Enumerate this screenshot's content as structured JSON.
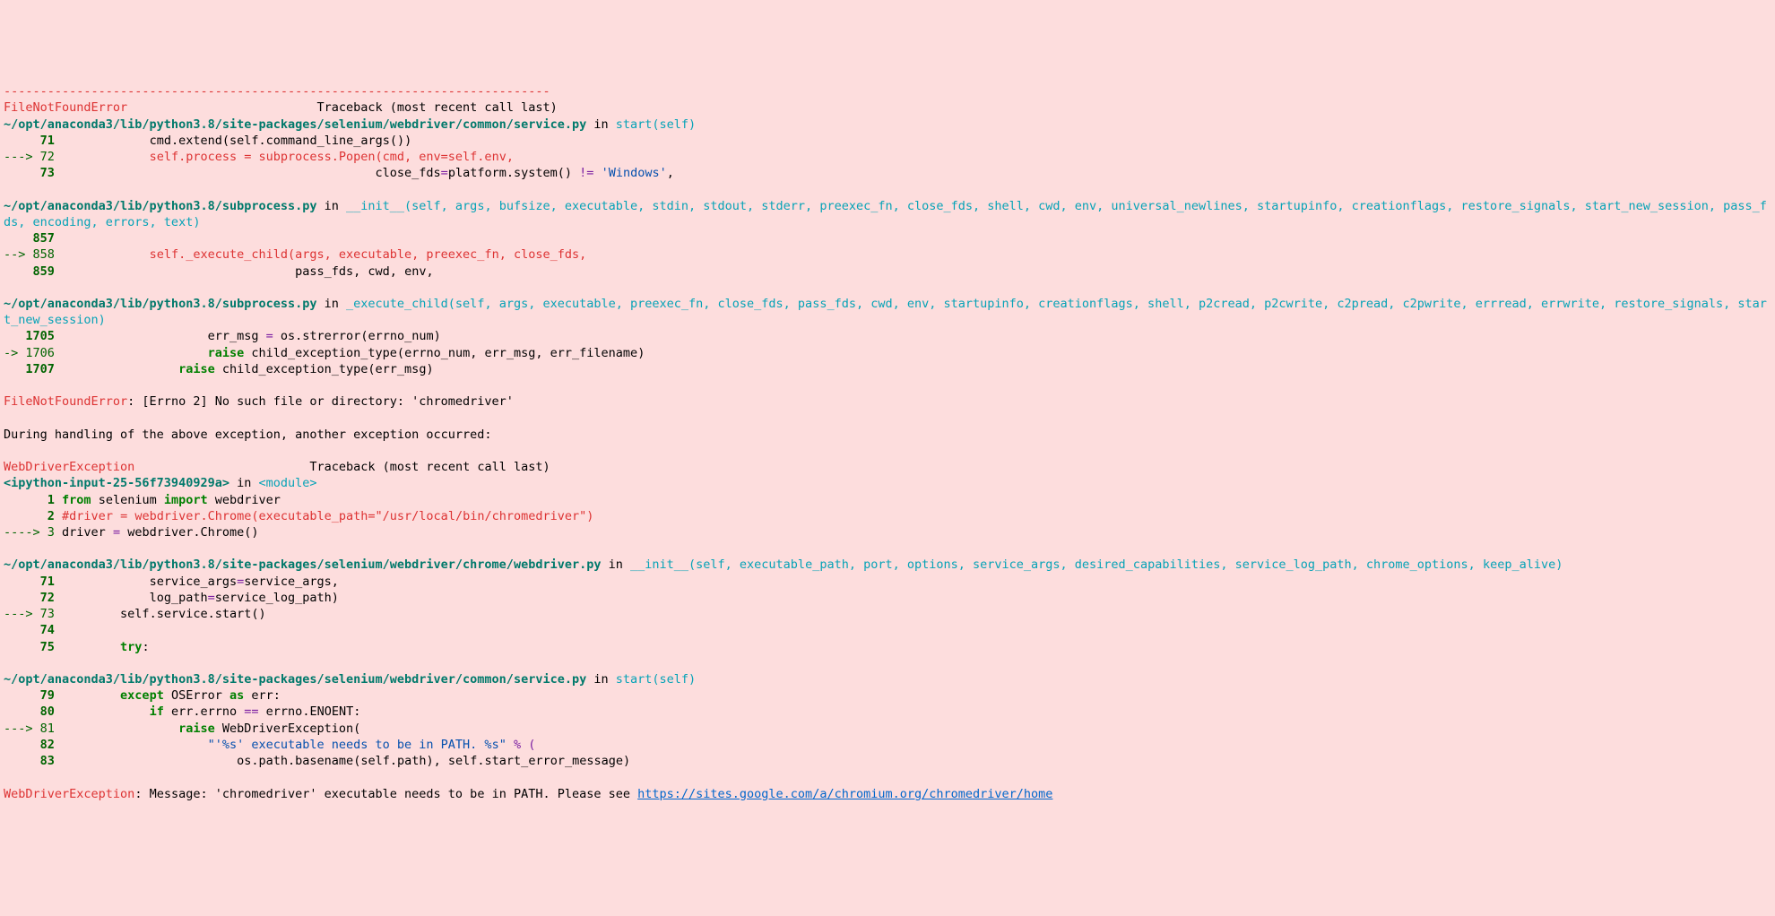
{
  "hr": "---------------------------------------------------------------------------",
  "err1": {
    "name": "FileNotFoundError",
    "pad": "                          ",
    "header": "Traceback (most recent call last)"
  },
  "f1": {
    "path": "~/opt/anaconda3/lib/python3.8/site-packages/selenium/webdriver/common/service.py",
    "in": " in ",
    "sig": "start(self)",
    "l71_no": "     71 ",
    "l71_code": "            cmd",
    "l71_dot": ".",
    "l71_ext": "extend",
    "l71_p1": "(",
    "l71_self": "self",
    "l71_dot2": ".",
    "l71_cmd": "command_line_args",
    "l71_p2": "())",
    "l72_arrow": "---> 72 ",
    "l72_code": "            self.process = subprocess.Popen(cmd, env=self.env,",
    "l73_no": "     73 ",
    "l73_pad": "                                           close_fds",
    "l73_eq": "=",
    "l73_plat": "platform",
    "l73_dot": ".",
    "l73_sys": "system",
    "l73_p": "() ",
    "l73_ne": "!=",
    "l73_sp": " ",
    "l73_str": "'Windows'",
    "l73_end": ","
  },
  "f2": {
    "path": "~/opt/anaconda3/lib/python3.8/subprocess.py",
    "in": " in ",
    "sig": "__init__(self, args, bufsize, executable, stdin, stdout, stderr, preexec_fn, close_fds, shell, cwd, env, universal_newlines, startupinfo, creationflags, restore_signals, start_new_session, pass_fds, encoding, errors, text)",
    "l857_no": "    857 ",
    "l858_arrow": "--> 858 ",
    "l858_code": "            self._execute_child(args, executable, preexec_fn, close_fds,",
    "l859_no": "    859 ",
    "l859_code": "                                pass_fds",
    "l859_p": ",",
    "l859_cwd": " cwd",
    "l859_p2": ",",
    "l859_env": " env",
    "l859_end": ","
  },
  "f3": {
    "path": "~/opt/anaconda3/lib/python3.8/subprocess.py",
    "in": " in ",
    "sig": "_execute_child(self, args, executable, preexec_fn, close_fds, pass_fds, cwd, env, startupinfo, creationflags, shell, p2cread, p2cwrite, c2pread, c2pwrite, errread, errwrite, restore_signals, start_new_session)",
    "l1705_no": "   1705 ",
    "l1705_code": "                    err_msg ",
    "l1705_eq": "=",
    "l1705_os": " os",
    "l1705_dot": ".",
    "l1705_str": "strerror",
    "l1705_p": "(",
    "l1705_en": "errno_num",
    "l1705_end": ")",
    "l1706_arrow": "-> 1706 ",
    "l1706_raise": "                    raise",
    "l1706_code": " child_exception_type",
    "l1706_p": "(",
    "l1706_args": "errno_num",
    "l1706_c1": ", ",
    "l1706_a2": "err_msg",
    "l1706_c2": ", ",
    "l1706_a3": "err_filename",
    "l1706_end": ")",
    "l1707_no": "   1707 ",
    "l1707_raise": "                raise",
    "l1707_code": " child_exception_type",
    "l1707_p": "(",
    "l1707_arg": "err_msg",
    "l1707_end": ")"
  },
  "msg1": {
    "name": "FileNotFoundError",
    "text": ": [Errno 2] No such file or directory: 'chromedriver'"
  },
  "during": "During handling of the above exception, another exception occurred:",
  "err2": {
    "name": "WebDriverException",
    "pad": "                        ",
    "header": "Traceback (most recent call last)"
  },
  "f4": {
    "path": "<ipython-input-25-56f73940929a>",
    "in": " in ",
    "sig": "<module>",
    "l1_no": "      1 ",
    "l1_from": "from",
    "l1_sel": " selenium ",
    "l1_imp": "import",
    "l1_wd": " webdriver",
    "l2_no": "      2 ",
    "l2_comment": "#driver = webdriver.Chrome(executable_path=\"/usr/local/bin/chromedriver\")",
    "l3_arrow": "----> 3 ",
    "l3_code": "driver ",
    "l3_eq": "=",
    "l3_wd": " webdriver",
    "l3_dot": ".",
    "l3_chr": "Chrome",
    "l3_p": "()"
  },
  "f5": {
    "path": "~/opt/anaconda3/lib/python3.8/site-packages/selenium/webdriver/chrome/webdriver.py",
    "in": " in ",
    "sig": "__init__(self, executable_path, port, options, service_args, desired_capabilities, service_log_path, chrome_options, keep_alive)",
    "l71_no": "     71 ",
    "l71_code": "            service_args",
    "l71_eq": "=",
    "l71_v": "service_args",
    "l71_end": ",",
    "l72_no": "     72 ",
    "l72_code": "            log_path",
    "l72_eq": "=",
    "l72_v": "service_log_path",
    "l72_end": ")",
    "l73_arrow": "---> 73 ",
    "l73_code": "        self",
    "l73_dot": ".",
    "l73_svc": "service",
    "l73_dot2": ".",
    "l73_start": "start",
    "l73_p": "()",
    "l74_no": "     74 ",
    "l75_no": "     75 ",
    "l75_try": "        try",
    "l75_colon": ":"
  },
  "f6": {
    "path": "~/opt/anaconda3/lib/python3.8/site-packages/selenium/webdriver/common/service.py",
    "in": " in ",
    "sig": "start(self)",
    "l79_no": "     79 ",
    "l79_exc": "        except",
    "l79_os": " OSError ",
    "l79_as": "as",
    "l79_err": " err",
    "l79_colon": ":",
    "l80_no": "     80 ",
    "l80_if": "            if",
    "l80_code": " err",
    "l80_dot": ".",
    "l80_errno": "errno ",
    "l80_eq": "==",
    "l80_sp": " errno",
    "l80_dot2": ".",
    "l80_en": "ENOENT",
    "l80_colon": ":",
    "l81_arrow": "---> 81 ",
    "l81_raise": "                raise",
    "l81_wde": " WebDriverException",
    "l81_p": "(",
    "l82_no": "     82 ",
    "l82_str": "                    \"'%s' executable needs to be in PATH. %s\"",
    "l82_pct": " % (",
    "l83_no": "     83 ",
    "l83_code": "                        os",
    "l83_dot": ".",
    "l83_path": "path",
    "l83_dot2": ".",
    "l83_bn": "basename",
    "l83_p": "(",
    "l83_self": "self",
    "l83_dot3": ".",
    "l83_pth": "path",
    "l83_p2": "), ",
    "l83_s2": "self",
    "l83_dot4": ".",
    "l83_sem": "start_error_message",
    "l83_end": ")"
  },
  "msg2": {
    "name": "WebDriverException",
    "text": ": Message: 'chromedriver' executable needs to be in PATH. Please see ",
    "link": "https://sites.google.com/a/chromium.org/chromedriver/home"
  }
}
